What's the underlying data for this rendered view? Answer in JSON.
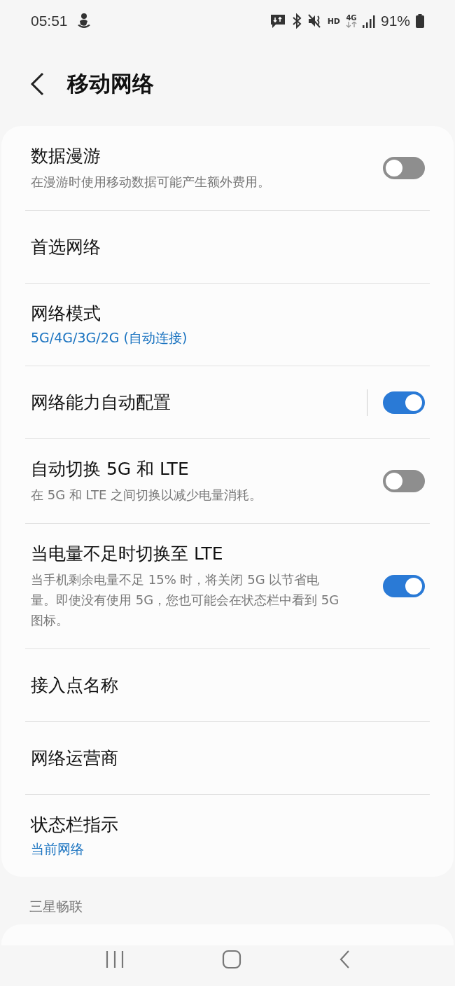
{
  "status_bar": {
    "time": "05:51",
    "battery": "91%",
    "network": "4G",
    "hd": "HD"
  },
  "header": {
    "title": "移动网络"
  },
  "settings": [
    {
      "kind": "toggle",
      "title": "数据漫游",
      "summary": "在漫游时使用移动数据可能产生额外费用。",
      "on": false
    },
    {
      "kind": "plain",
      "title": "首选网络"
    },
    {
      "kind": "plain",
      "title": "网络模式",
      "value": "5G/4G/3G/2G (自动连接)"
    },
    {
      "kind": "split_toggle",
      "title": "网络能力自动配置",
      "on": true
    },
    {
      "kind": "toggle",
      "title": "自动切换 5G 和 LTE",
      "summary": "在 5G 和 LTE 之间切换以减少电量消耗。",
      "on": false
    },
    {
      "kind": "toggle",
      "title": "当电量不足时切换至 LTE",
      "summary": "当手机剩余电量不足 15% 时，将关闭 5G 以节省电量。即使没有使用 5G，您也可能会在状态栏中看到 5G 图标。",
      "on": true
    },
    {
      "kind": "plain",
      "title": "接入点名称"
    },
    {
      "kind": "plain",
      "title": "网络运营商"
    },
    {
      "kind": "plain",
      "title": "状态栏指示",
      "value": "当前网络"
    }
  ],
  "section": {
    "title": "三星畅联"
  }
}
